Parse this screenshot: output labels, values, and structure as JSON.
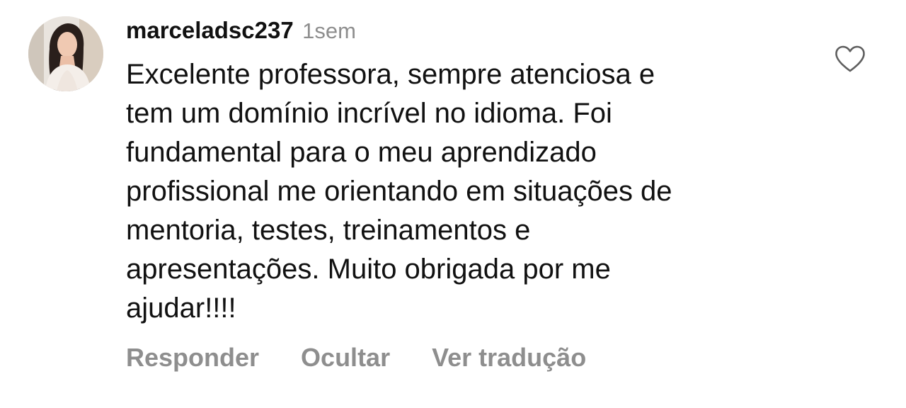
{
  "comment": {
    "username": "marceladsc237",
    "timestamp": "1sem",
    "text": "Excelente professora, sempre atenciosa e\ntem um domínio incrível no idioma. Foi\nfundamental para o meu aprendizado\nprofissional me orientando em situações de\nmentoria, testes, treinamentos e\napresentações.  Muito obrigada por me\najudar!!!!",
    "like_icon": "heart-outline-icon",
    "actions": {
      "reply": "Responder",
      "hide": "Ocultar",
      "translate": "Ver tradução"
    }
  },
  "colors": {
    "text_primary": "#111111",
    "text_secondary": "#8e8e8e",
    "background": "#ffffff"
  }
}
